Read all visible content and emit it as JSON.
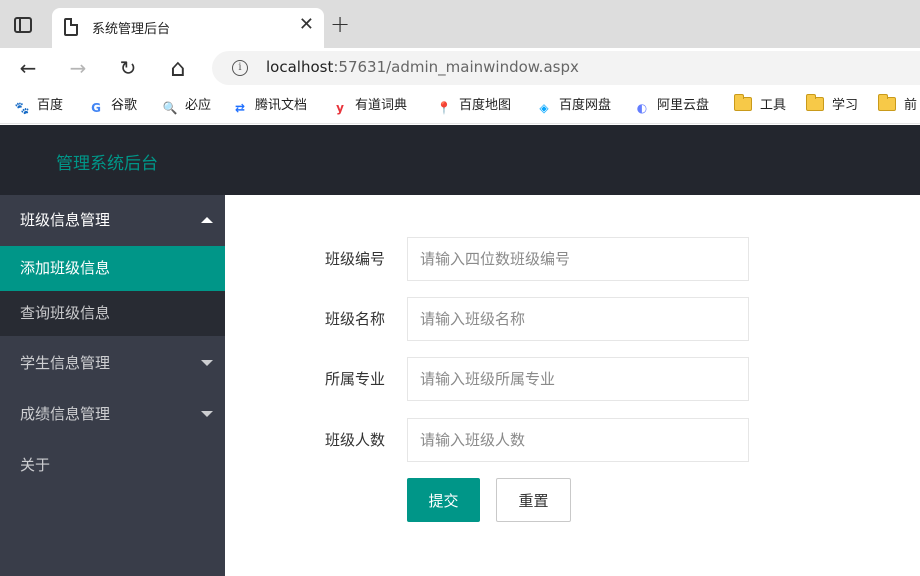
{
  "browser": {
    "tab_title": "系统管理后台",
    "tab_close": "✕",
    "new_tab": "+",
    "nav": {
      "back": "←",
      "forward": "→",
      "reload": "↻",
      "home": "⌂"
    },
    "url_host": "localhost",
    "url_path": ":57631/admin_mainwindow.aspx",
    "info_glyph": "i",
    "bookmarks": [
      {
        "label": "百度",
        "icon": "baidu-icon",
        "glyph": "🐾",
        "color": "#2932e1"
      },
      {
        "label": "谷歌",
        "icon": "google-icon",
        "glyph": "G",
        "color": "#4285f4"
      },
      {
        "label": "必应",
        "icon": "search-icon",
        "glyph": "🔍",
        "color": "#1a73e8"
      },
      {
        "label": "腾讯文档",
        "icon": "tencent-docs-icon",
        "glyph": "⇄",
        "color": "#1e6fff"
      },
      {
        "label": "有道词典",
        "icon": "youdao-icon",
        "glyph": "y",
        "color": "#e8333a"
      },
      {
        "label": "百度地图",
        "icon": "map-pin-icon",
        "glyph": "📍",
        "color": "#e94335"
      },
      {
        "label": "百度网盘",
        "icon": "cloud-drive-icon",
        "glyph": "◈",
        "color": "#06a7ff"
      },
      {
        "label": "阿里云盘",
        "icon": "aliyun-drive-icon",
        "glyph": "◐",
        "color": "#637dff"
      },
      {
        "label": "工具",
        "icon": "folder-icon"
      },
      {
        "label": "学习",
        "icon": "folder-icon"
      },
      {
        "label": "前",
        "icon": "folder-icon"
      }
    ]
  },
  "app": {
    "title": "管理系统后台",
    "accent_color": "#009688"
  },
  "sidebar": {
    "groups": [
      {
        "label": "班级信息管理",
        "expanded": true,
        "items": [
          {
            "label": "添加班级信息",
            "active": true
          },
          {
            "label": "查询班级信息",
            "active": false
          }
        ]
      },
      {
        "label": "学生信息管理",
        "expanded": false
      },
      {
        "label": "成绩信息管理",
        "expanded": false
      }
    ],
    "about": "关于"
  },
  "form": {
    "fields": [
      {
        "label": "班级编号",
        "placeholder": "请输入四位数班级编号",
        "value": ""
      },
      {
        "label": "班级名称",
        "placeholder": "请输入班级名称",
        "value": ""
      },
      {
        "label": "所属专业",
        "placeholder": "请输入班级所属专业",
        "value": ""
      },
      {
        "label": "班级人数",
        "placeholder": "请输入班级人数",
        "value": ""
      }
    ],
    "submit_label": "提交",
    "reset_label": "重置"
  }
}
